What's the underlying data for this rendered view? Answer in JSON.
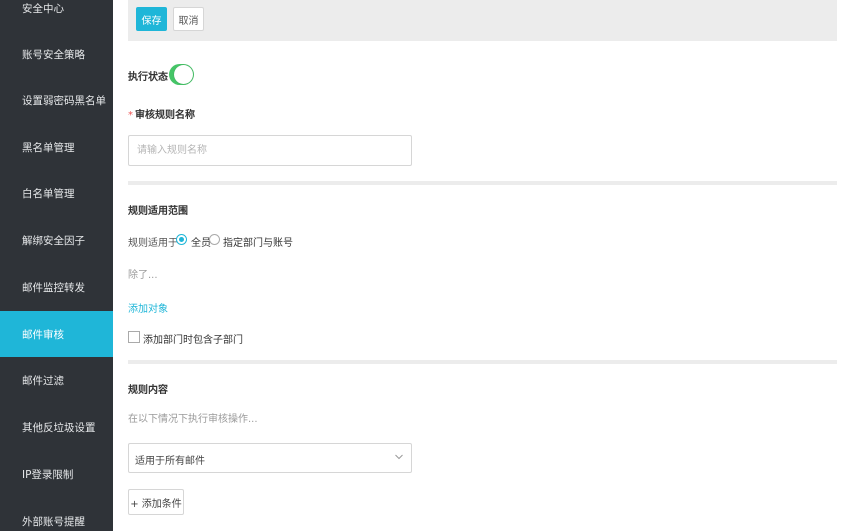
{
  "sidebar": {
    "items": [
      {
        "label": "安全中心"
      },
      {
        "label": "账号安全策略"
      },
      {
        "label": "设置弱密码黑名单"
      },
      {
        "label": "黑名单管理"
      },
      {
        "label": "白名单管理"
      },
      {
        "label": "解绑安全因子"
      },
      {
        "label": "邮件监控转发"
      },
      {
        "label": "邮件审核"
      },
      {
        "label": "邮件过滤"
      },
      {
        "label": "其他反垃圾设置"
      },
      {
        "label": "IP登录限制"
      },
      {
        "label": "外部账号提醒"
      }
    ],
    "active_index": 7
  },
  "toolbar": {
    "save_label": "保存",
    "cancel_label": "取消"
  },
  "form": {
    "status_label": "执行状态",
    "status_on": true,
    "required_mark": "*",
    "name_label": "审核规则名称",
    "name_placeholder": "请输入规则名称",
    "name_value": "",
    "scope_section_title": "规则适用范围",
    "scope_applies_label": "规则适用于",
    "scope_options": [
      {
        "label": "全员",
        "checked": true
      },
      {
        "label": "指定部门与账号",
        "checked": false
      }
    ],
    "except_label": "除了...",
    "add_target_link": "添加对象",
    "include_subdept_label": "添加部门时包含子部门",
    "include_subdept_checked": false,
    "content_section_title": "规则内容",
    "content_hint": "在以下情况下执行审核操作...",
    "mail_scope_select": "适用于所有邮件",
    "add_condition_label": "+ 添加条件"
  },
  "colors": {
    "accent": "#1fb6d8",
    "toggle_on": "#45c567",
    "sidebar_bg": "#2f3338"
  }
}
